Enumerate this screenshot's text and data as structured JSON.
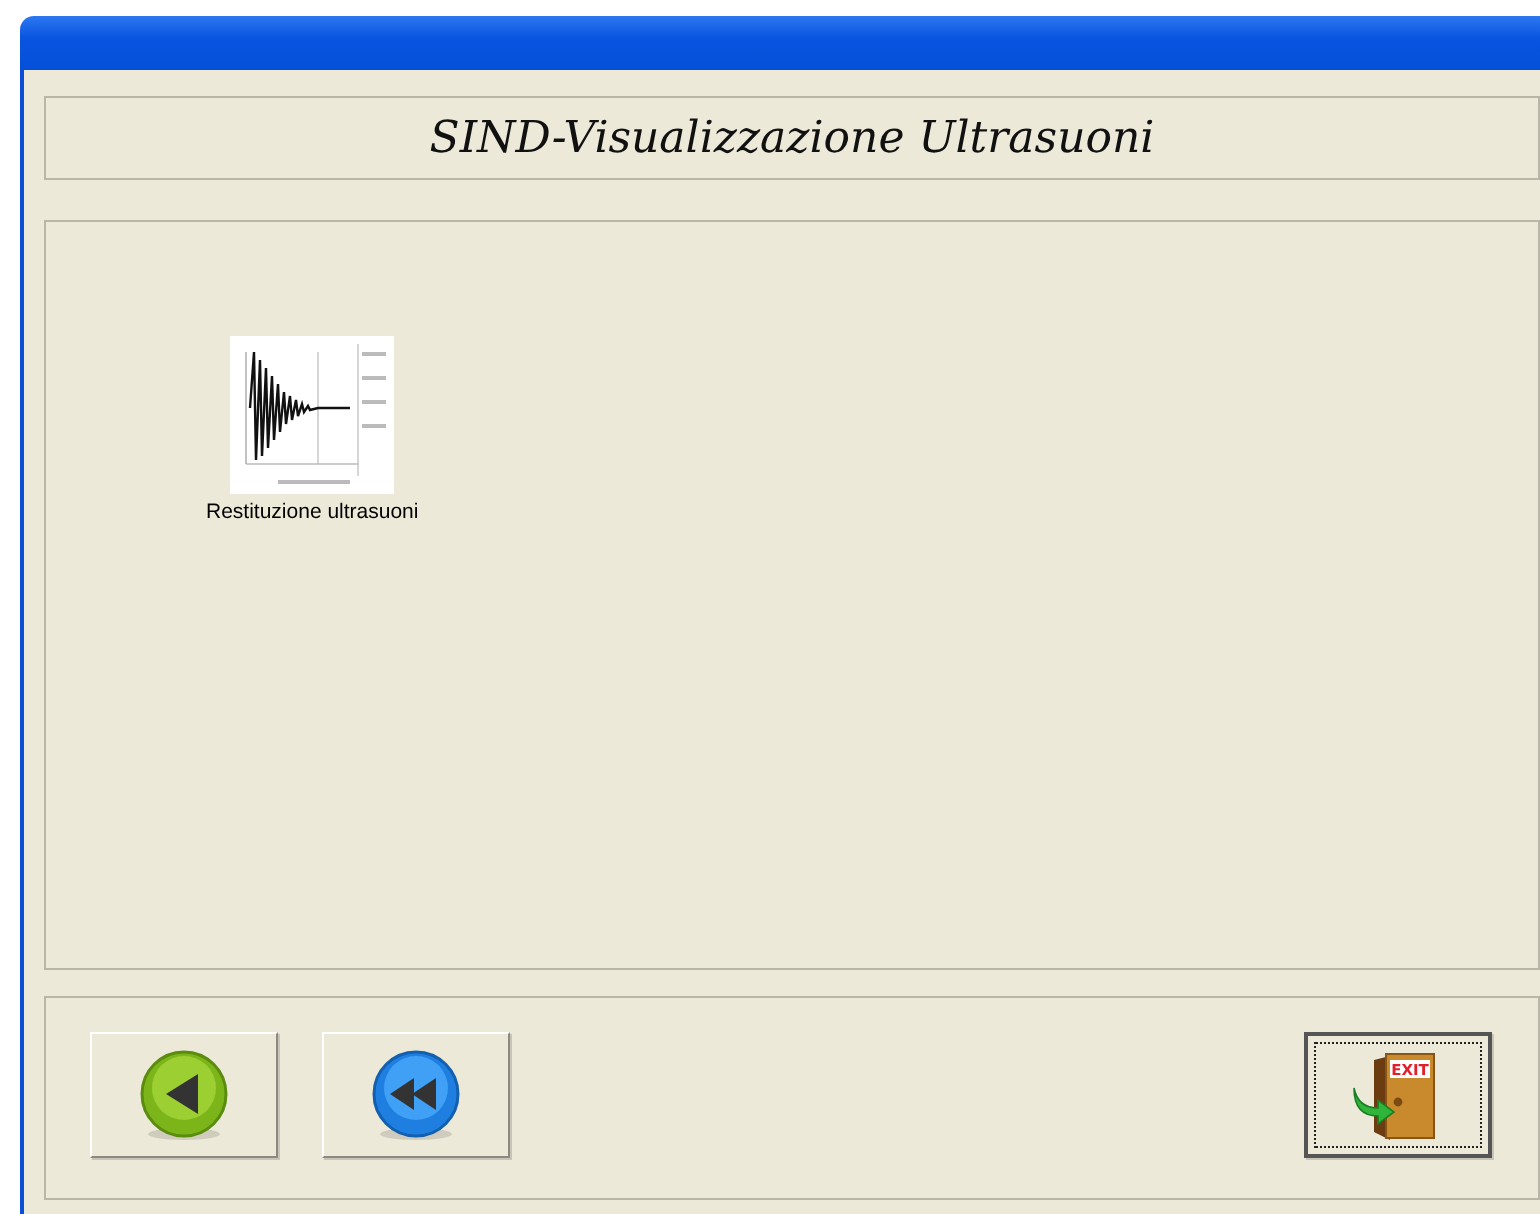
{
  "window": {
    "title": "SIND-Visualizzazione Ultrasuoni"
  },
  "items": [
    {
      "label": "Restituzione ultrasuoni",
      "selected": false
    }
  ],
  "buttons": [
    {
      "kind": "back"
    },
    {
      "kind": "rewind"
    },
    {
      "kind": "exit",
      "sign": "EXIT",
      "focused": true
    }
  ]
}
